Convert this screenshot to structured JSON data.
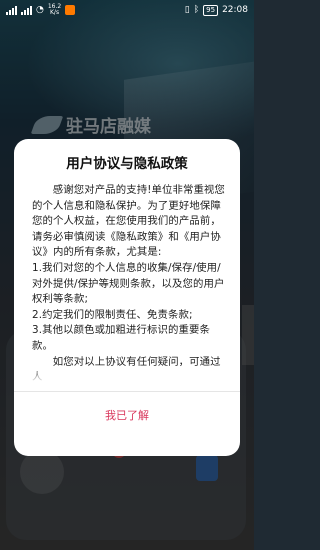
{
  "status_bar": {
    "net_speed": "16.2\nK/s",
    "battery": "95",
    "time": "22:08"
  },
  "background": {
    "logo_text": "驻马店融媒"
  },
  "dialog": {
    "title": "用户协议与隐私政策",
    "paragraphs": [
      "感谢您对产品的支持!单位非常重视您的个人信息和隐私保护。为了更好地保障您的个人权益，在您使用我们的产品前，请务必审慎阅读《隐私政策》和《用户协议》内的所有条款，尤其是:",
      "1.我们对您的个人信息的收集/保存/使用/对外提供/保护等规则条款，以及您的用户权利等条款;",
      "2.约定我们的限制责任、免责条款;",
      "3.其他以颜色或加粗进行标识的重要条款。",
      "如您对以上协议有任何疑问，可通过人"
    ],
    "confirm_label": "我已了解"
  }
}
